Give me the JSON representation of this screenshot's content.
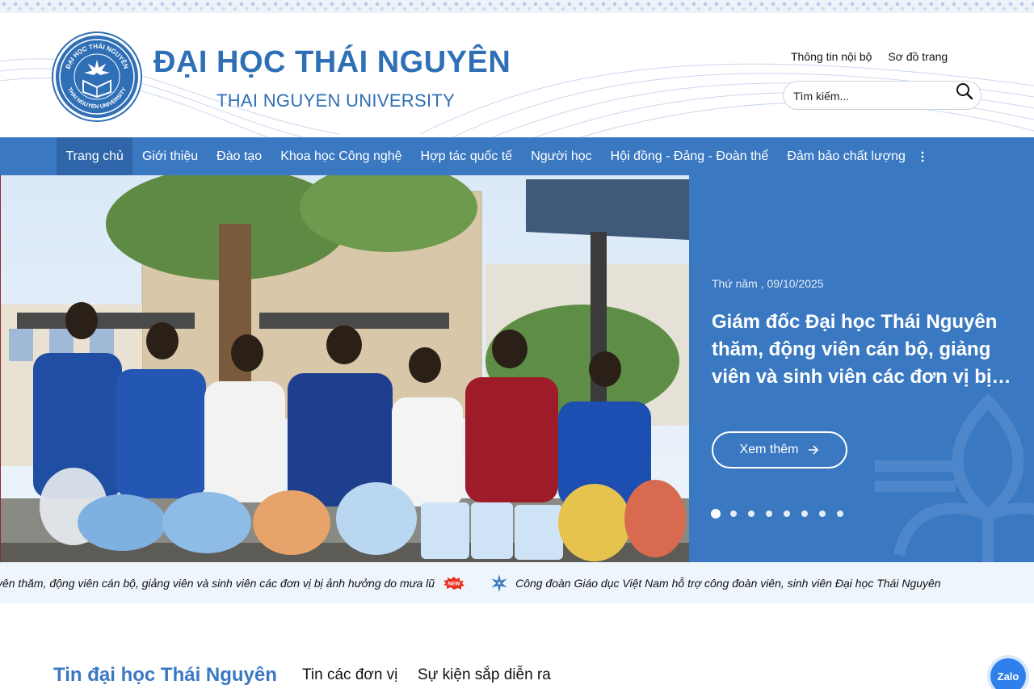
{
  "header": {
    "brand_vn": "ĐẠI HỌC THÁI NGUYÊN",
    "brand_en": "THAI NGUYEN UNIVERSITY",
    "seal_text_top": "ĐẠI HỌC THÁI NGUYÊN",
    "seal_text_bottom": "THAI NGUYEN UNIVERSITY",
    "top_links": [
      "Thông tin nội bộ",
      "Sơ đồ trang"
    ],
    "search_placeholder": "Tìm kiếm...",
    "search_icon": "search-icon"
  },
  "nav": {
    "items": [
      "Trang chủ",
      "Giới thiệu",
      "Đào tạo",
      "Khoa học Công nghệ",
      "Hợp tác quốc tế",
      "Người học",
      "Hội đồng - Đảng - Đoàn thể",
      "Đảm bảo chất lượng"
    ],
    "active_index": 0,
    "more_icon": "more-vertical-icon"
  },
  "hero": {
    "date": "Thứ năm , 09/10/2025",
    "title": "Giám đốc Đại học Thái Nguyên thăm, động viên cán bộ, giảng viên và sinh viên các đơn vị bị ảnh hưởng do mưa lũ",
    "button_label": "Xem thêm",
    "button_icon": "arrow-right-icon",
    "slide_count": 8,
    "active_slide": 1
  },
  "ticker": {
    "items": [
      "Giám đốc Đại học Thái Nguyên thăm, động viên cán bộ, giảng viên và sinh viên các đơn vị bị ảnh hưởng do mưa lũ",
      "Công đoàn Giáo dục Việt Nam hỗ trợ công đoàn viên, sinh viên Đại học Thái Nguyên"
    ],
    "new_badge": "NEW"
  },
  "news": {
    "title": "Tin đại học Thái Nguyên",
    "tabs": [
      "Tin các đơn vị",
      "Sự kiện sắp diễn ra"
    ]
  },
  "zalo": {
    "label": "Zalo"
  },
  "colors": {
    "primary": "#3a78c2",
    "nav_active": "#2f66aa",
    "brand": "#2f6fb6",
    "ticker_bg": "#eef5fb"
  }
}
